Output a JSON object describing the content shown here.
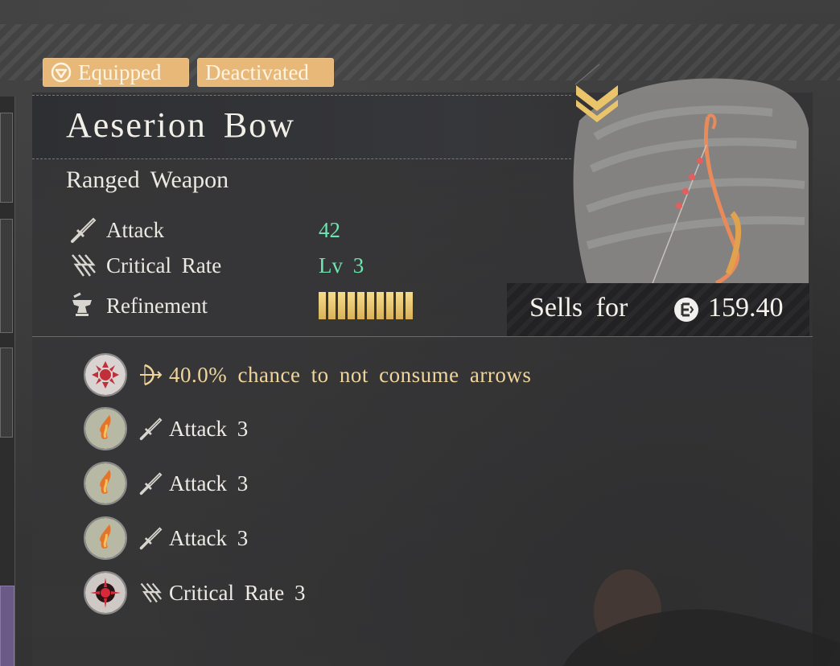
{
  "tags": {
    "equipped": "Equipped",
    "deactivated": "Deactivated"
  },
  "item": {
    "name": "Aeserion Bow",
    "type": "Ranged Weapon"
  },
  "stats": [
    {
      "label": "Attack",
      "value": "42",
      "icon": "sword-icon"
    },
    {
      "label": "Critical Rate",
      "value": "Lv 3",
      "icon": "critical-claw-icon"
    },
    {
      "label": "Refinement",
      "value_bars": 10,
      "icon": "anvil-icon"
    }
  ],
  "sell": {
    "label": "Sells for",
    "value": "159.40",
    "icon": "coin-icon"
  },
  "bonuses": [
    {
      "text": "40.0% chance to not consume arrows",
      "icon": "bow-icon",
      "orb": "spiked-red-orb"
    },
    {
      "text": "Attack 3",
      "icon": "sword-icon",
      "orb": "flame-orb"
    },
    {
      "text": "Attack 3",
      "icon": "sword-icon",
      "orb": "flame-orb"
    },
    {
      "text": "Attack 3",
      "icon": "sword-icon",
      "orb": "flame-orb"
    },
    {
      "text": "Critical Rate 3",
      "icon": "critical-claw-icon",
      "orb": "crimson-burst-orb"
    }
  ],
  "colors": {
    "tag": "#e8b878",
    "stat_value": "#6fe3b0",
    "refine_bar": "#e6c26c",
    "special_bonus": "#efd59a",
    "rank_chevron": "#e9c46a"
  }
}
